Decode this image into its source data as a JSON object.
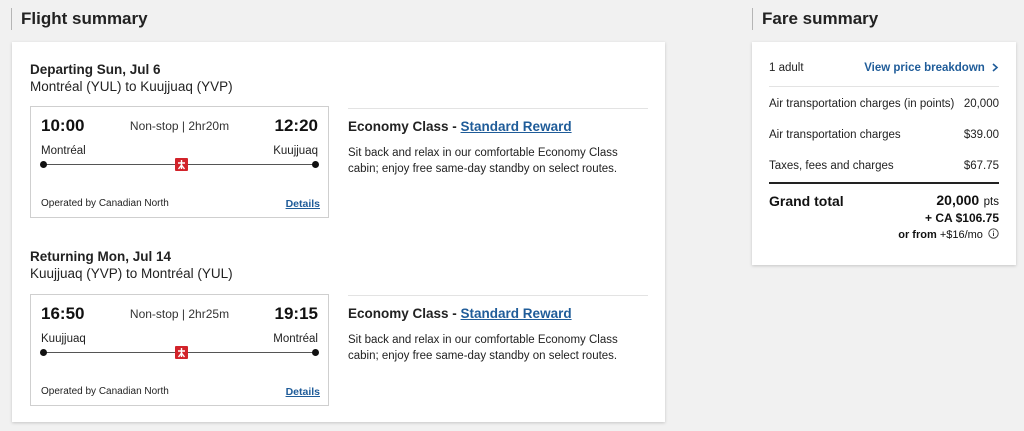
{
  "flight_summary": {
    "title": "Flight summary",
    "segments": [
      {
        "date": "Departing Sun, Jul 6",
        "route": "Montréal (YUL) to Kuujjuaq (YVP)",
        "dep_time": "10:00",
        "arr_time": "12:20",
        "duration": "Non-stop | 2hr20m",
        "from_city": "Montréal",
        "to_city": "Kuujjuaq",
        "operator": "Operated by Canadian North",
        "details_label": "Details",
        "cabin_prefix": "Economy Class - ",
        "cabin_link": "Standard Reward",
        "cabin_desc": "Sit back and relax in our comfortable Economy Class cabin; enjoy free same-day standby on select routes."
      },
      {
        "date": "Returning Mon, Jul 14",
        "route": "Kuujjuaq (YVP) to Montréal (YUL)",
        "dep_time": "16:50",
        "arr_time": "19:15",
        "duration": "Non-stop | 2hr25m",
        "from_city": "Kuujjuaq",
        "to_city": "Montréal",
        "operator": "Operated by Canadian North",
        "details_label": "Details",
        "cabin_prefix": "Economy Class - ",
        "cabin_link": "Standard Reward",
        "cabin_desc": "Sit back and relax in our comfortable Economy Class cabin; enjoy free same-day standby on select routes."
      }
    ]
  },
  "fare_summary": {
    "title": "Fare summary",
    "passengers": "1 adult",
    "breakdown_link": "View price breakdown",
    "rows": [
      {
        "label": "Air transportation charges (in points)",
        "value": "20,000"
      },
      {
        "label": "Air transportation charges",
        "value": "$39.00"
      },
      {
        "label": "Taxes, fees and charges",
        "value": "$67.75"
      }
    ],
    "grand_total_label": "Grand total",
    "total_points": "20,000",
    "points_unit": "pts",
    "total_cash": "+ CA $106.75",
    "monthly_prefix": "or from ",
    "monthly_amount": "+$16/mo"
  },
  "icons": {
    "airline_logo": "canadian-north-logo",
    "chevron": "chevron-right-icon",
    "info": "info-icon"
  },
  "colors": {
    "link": "#1f5c99",
    "logo_red": "#d2232a",
    "background": "#f1f1f1"
  }
}
